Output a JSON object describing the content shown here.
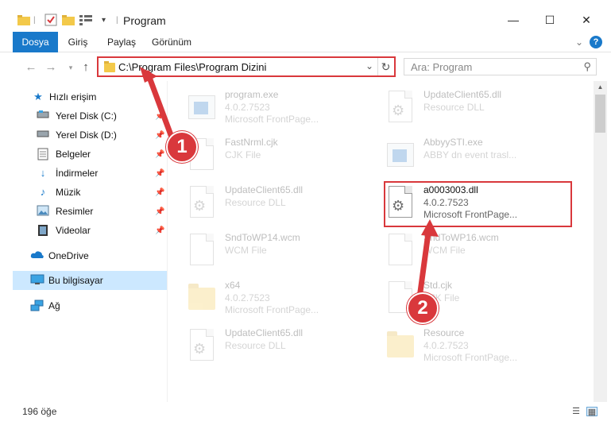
{
  "window": {
    "title": "Program",
    "minimize": "—",
    "maximize": "☐",
    "close": "✕"
  },
  "ribbon": {
    "tabs": [
      {
        "label": "Dosya"
      },
      {
        "label": "Giriş"
      },
      {
        "label": "Paylaş"
      },
      {
        "label": "Görünüm"
      }
    ],
    "help": "?",
    "expand": "⌄"
  },
  "address": {
    "path": "C:\\Program Files\\Program Dizini",
    "search_placeholder": "Ara: Program"
  },
  "sidebar": {
    "items": [
      {
        "label": "Hızlı erişim",
        "icon": "star-icon"
      },
      {
        "label": "Yerel Disk (C:)",
        "icon": "drive-icon",
        "pinned": true
      },
      {
        "label": "Yerel Disk (D:)",
        "icon": "drive-icon",
        "pinned": true
      },
      {
        "label": "Belgeler",
        "icon": "documents-icon",
        "pinned": true
      },
      {
        "label": "İndirmeler",
        "icon": "downloads-icon",
        "pinned": true
      },
      {
        "label": "Müzik",
        "icon": "music-icon",
        "pinned": true
      },
      {
        "label": "Resimler",
        "icon": "pictures-icon",
        "pinned": true
      },
      {
        "label": "Videolar",
        "icon": "videos-icon",
        "pinned": true
      },
      {
        "label": "OneDrive",
        "icon": "cloud-icon"
      },
      {
        "label": "Bu bilgisayar",
        "icon": "computer-icon",
        "selected": true
      },
      {
        "label": "Ağ",
        "icon": "network-icon"
      }
    ]
  },
  "files": [
    {
      "name": "program.exe",
      "line2": "4.0.2.7523",
      "line3": "Microsoft FrontPage...",
      "icon": "exe-icon",
      "faded": true
    },
    {
      "name": "UpdateClient65.dll",
      "line2": "Resource DLL",
      "line3": "",
      "icon": "dll-icon",
      "faded": true
    },
    {
      "name": "FastNrml.cjk",
      "line2": "CJK File",
      "line3": "",
      "icon": "file-icon",
      "faded": true
    },
    {
      "name": "AbbyySTI.exe",
      "line2": "ABBY dn event trasl...",
      "line3": "",
      "icon": "exe-icon",
      "faded": true
    },
    {
      "name": "UpdateClient65.dll",
      "line2": "Resource DLL",
      "line3": "",
      "icon": "dll-icon",
      "faded": true
    },
    {
      "name": "a0003003.dll",
      "line2": "4.0.2.7523",
      "line3": "Microsoft FrontPage...",
      "icon": "dll-icon",
      "faded": false
    },
    {
      "name": "SndToWP14.wcm",
      "line2": "WCM File",
      "line3": "",
      "icon": "file-icon",
      "faded": true
    },
    {
      "name": "SndToWP16.wcm",
      "line2": "WCM File",
      "line3": "",
      "icon": "file-icon",
      "faded": true
    },
    {
      "name": "x64",
      "line2": "4.0.2.7523",
      "line3": "Microsoft FrontPage...",
      "icon": "folder-icon",
      "faded": true
    },
    {
      "name": "Std.cjk",
      "line2": "CJK File",
      "line3": "",
      "icon": "file-icon",
      "faded": true
    },
    {
      "name": "UpdateClient65.dll",
      "line2": "Resource DLL",
      "line3": "",
      "icon": "dll-icon",
      "faded": true
    },
    {
      "name": "Resource",
      "line2": "4.0.2.7523",
      "line3": "Microsoft FrontPage...",
      "icon": "folder-icon",
      "faded": true
    }
  ],
  "status": {
    "count": "196 öğe"
  },
  "annotations": {
    "callout1": "1",
    "callout2": "2",
    "color": "#d9383c"
  }
}
